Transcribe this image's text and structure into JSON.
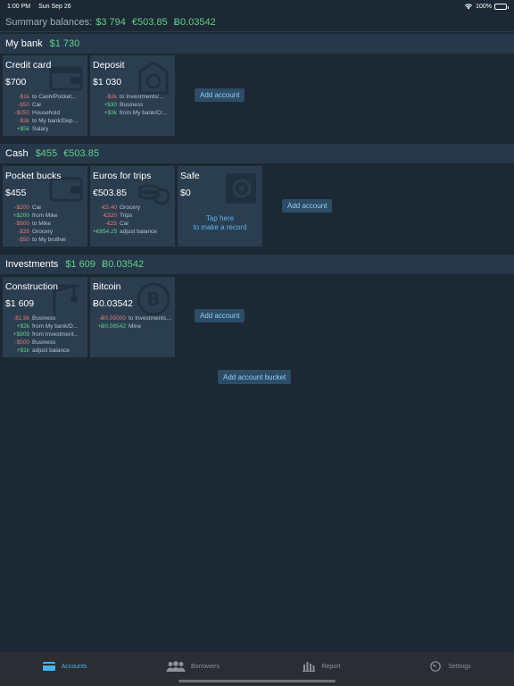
{
  "status": {
    "time": "1:00 PM",
    "date": "Sun Sep 26",
    "battery": "100%"
  },
  "summary": {
    "label": "Summary balances:",
    "values": [
      "$3 794",
      "€503.85",
      "Ƀ0.03542"
    ]
  },
  "add_account_label": "Add account",
  "add_bucket_label": "Add account bucket",
  "buckets": [
    {
      "title": "My bank",
      "totals": [
        "$1 730"
      ],
      "accounts": [
        {
          "name": "Credit card",
          "balance": "$700",
          "icon": "wallet-icon",
          "records": [
            {
              "amount": "-$1k",
              "sign": "neg",
              "desc": "to Cash/Pocket..."
            },
            {
              "amount": "-$50",
              "sign": "neg",
              "desc": "Car"
            },
            {
              "amount": "-$250",
              "sign": "neg",
              "desc": "Household"
            },
            {
              "amount": "-$3k",
              "sign": "neg",
              "desc": "to My bank/Dep..."
            },
            {
              "amount": "+$5k",
              "sign": "pos",
              "desc": "Salary"
            }
          ]
        },
        {
          "name": "Deposit",
          "balance": "$1 030",
          "icon": "piggy-bank-icon",
          "records": [
            {
              "amount": "-$2k",
              "sign": "neg",
              "desc": "to Investments/..."
            },
            {
              "amount": "+$30",
              "sign": "pos",
              "desc": "Business"
            },
            {
              "amount": "+$3k",
              "sign": "pos",
              "desc": "from My bank/Cr..."
            }
          ]
        }
      ]
    },
    {
      "title": "Cash",
      "totals": [
        "$455",
        "€503.85"
      ],
      "accounts": [
        {
          "name": "Pocket bucks",
          "balance": "$455",
          "icon": "wallet-icon",
          "records": [
            {
              "amount": "-$200",
              "sign": "neg",
              "desc": "Car"
            },
            {
              "amount": "+$200",
              "sign": "pos",
              "desc": "from Mike"
            },
            {
              "amount": "-$500",
              "sign": "neg",
              "desc": "to Mike"
            },
            {
              "amount": "-$35",
              "sign": "neg",
              "desc": "Grocery"
            },
            {
              "amount": "-$50",
              "sign": "neg",
              "desc": "to My brother"
            }
          ]
        },
        {
          "name": "Euros for trips",
          "balance": "€503.85",
          "icon": "coins-icon",
          "records": [
            {
              "amount": "-€5.40",
              "sign": "neg",
              "desc": "Grocery"
            },
            {
              "amount": "-€320",
              "sign": "neg",
              "desc": "Trips"
            },
            {
              "amount": "-€25",
              "sign": "neg",
              "desc": "Car"
            },
            {
              "amount": "+€854.25",
              "sign": "pos",
              "desc": "adjust balance"
            }
          ]
        },
        {
          "name": "Safe",
          "balance": "$0",
          "icon": "safe-icon",
          "hint": [
            "Tap here",
            "to make a record"
          ],
          "records": []
        }
      ]
    },
    {
      "title": "Investments",
      "totals": [
        "$1 609",
        "Ƀ0.03542"
      ],
      "accounts": [
        {
          "name": "Construction",
          "balance": "$1 609",
          "icon": "crane-icon",
          "records": [
            {
              "amount": "-$1.8k",
              "sign": "neg",
              "desc": "Business"
            },
            {
              "amount": "+$2k",
              "sign": "pos",
              "desc": "from My bank/D..."
            },
            {
              "amount": "+$909",
              "sign": "pos",
              "desc": "from Investment..."
            },
            {
              "amount": "-$500",
              "sign": "neg",
              "desc": "Business"
            },
            {
              "amount": "+$1k",
              "sign": "pos",
              "desc": "adjust balance"
            }
          ]
        },
        {
          "name": "Bitcoin",
          "balance": "Ƀ0.03542",
          "icon": "bitcoin-icon",
          "records": [
            {
              "amount": "-Ƀ0.05000",
              "sign": "neg",
              "desc": "to Investments/..."
            },
            {
              "amount": "+Ƀ0.08542",
              "sign": "pos",
              "desc": "Mine"
            }
          ]
        }
      ]
    }
  ],
  "tabs": [
    {
      "label": "Accounts",
      "icon": "card-icon",
      "active": true
    },
    {
      "label": "Borrowers",
      "icon": "people-icon",
      "active": false
    },
    {
      "label": "Report",
      "icon": "bar-chart-icon",
      "active": false
    },
    {
      "label": "Settings",
      "icon": "gauge-icon",
      "active": false
    }
  ],
  "colors": {
    "background": "#1c2833",
    "card": "#2b3e50",
    "header": "#27384a",
    "positive": "#5fd08a",
    "negative": "#e07a70",
    "accent": "#41b3ee"
  }
}
